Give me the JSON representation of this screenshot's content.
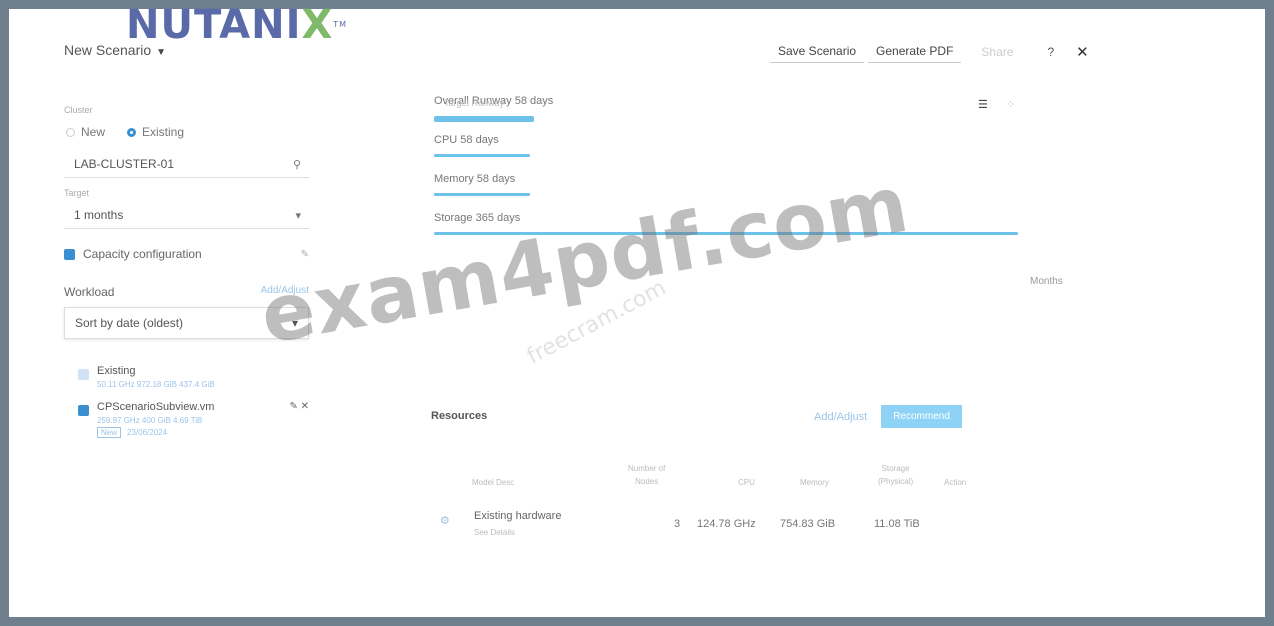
{
  "logo": {
    "text": "NUTANIX",
    "tm": "TM"
  },
  "header": {
    "title": "New Scenario",
    "actions": {
      "save": "Save Scenario",
      "pdf": "Generate PDF",
      "share": "Share"
    },
    "help_icon": "?",
    "close_icon": "✕"
  },
  "cluster": {
    "label": "Cluster",
    "options": [
      "New",
      "Existing"
    ],
    "selected": "Existing",
    "value": "LAB-CLUSTER-01"
  },
  "target": {
    "label": "Target",
    "value": "1 months"
  },
  "capacity": {
    "label": "Capacity configuration"
  },
  "workload": {
    "label": "Workload",
    "action": "Add/Adjust",
    "sort": "Sort by date (oldest)",
    "items": [
      {
        "name": "Existing",
        "meta": "50.11 GHz    972.18 GiB    437.4 GiB",
        "tag": "",
        "date": ""
      },
      {
        "name": "CPScenarioSubview.vm",
        "meta": "259.97 GHz    400 GiB    4.69 TiB",
        "tag": "New",
        "date": "23/06/2024"
      }
    ]
  },
  "runway": {
    "overall": "Overall Runway 58 days",
    "overlay": "Target Runway",
    "cpu": "CPU 58 days",
    "memory": "Memory 58 days",
    "storage": "Storage 365 days",
    "months_label": "Months"
  },
  "resources": {
    "title": "Resources",
    "add": "Add/Adjust",
    "recommend": "Recommend",
    "headers": {
      "model": "Model Desc",
      "nodes": [
        "Number of",
        "Nodes"
      ],
      "cpu": "CPU",
      "memory": "Memory",
      "storage": [
        "Storage",
        "(Physical)"
      ],
      "action": "Action"
    },
    "rows": [
      {
        "name": "Existing hardware",
        "sub": "See Details",
        "nodes": "3",
        "cpu": "124.78 GHz",
        "memory": "754.83 GiB",
        "storage": "11.08 TiB"
      }
    ]
  },
  "watermark": {
    "main": "exam4pdf.com",
    "sub": "freecram.com"
  }
}
